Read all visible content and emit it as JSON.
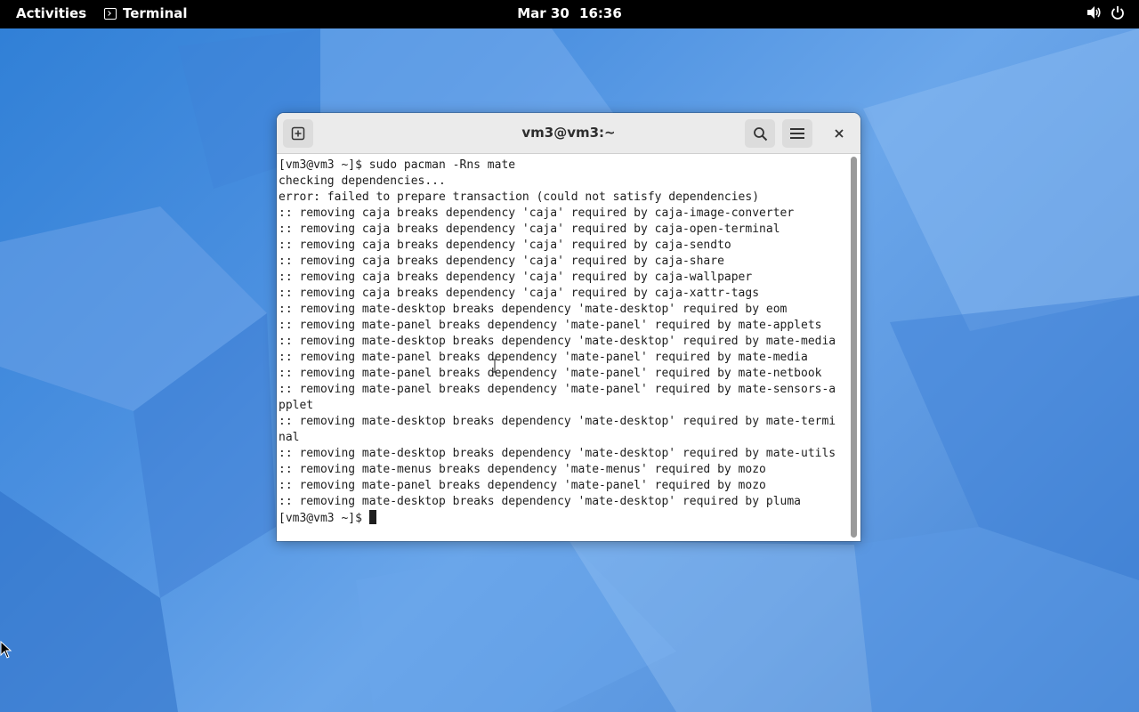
{
  "topbar": {
    "activities": "Activities",
    "app_name": "Terminal",
    "date": "Mar 30",
    "time": "16:36",
    "icons": [
      "terminal-icon",
      "volume-icon",
      "power-icon"
    ]
  },
  "window": {
    "title": "vm3@vm3:~",
    "buttons": [
      "new-tab-icon",
      "search-icon",
      "hamburger-menu-icon",
      "close-icon"
    ]
  },
  "terminal": {
    "lines": [
      "[vm3@vm3 ~]$ sudo pacman -Rns mate",
      "checking dependencies...",
      "error: failed to prepare transaction (could not satisfy dependencies)",
      ":: removing caja breaks dependency 'caja' required by caja-image-converter",
      ":: removing caja breaks dependency 'caja' required by caja-open-terminal",
      ":: removing caja breaks dependency 'caja' required by caja-sendto",
      ":: removing caja breaks dependency 'caja' required by caja-share",
      ":: removing caja breaks dependency 'caja' required by caja-wallpaper",
      ":: removing caja breaks dependency 'caja' required by caja-xattr-tags",
      ":: removing mate-desktop breaks dependency 'mate-desktop' required by eom",
      ":: removing mate-panel breaks dependency 'mate-panel' required by mate-applets",
      ":: removing mate-desktop breaks dependency 'mate-desktop' required by mate-media",
      ":: removing mate-panel breaks dependency 'mate-panel' required by mate-media",
      ":: removing mate-panel breaks dependency 'mate-panel' required by mate-netbook",
      ":: removing mate-panel breaks dependency 'mate-panel' required by mate-sensors-a",
      "pplet",
      ":: removing mate-desktop breaks dependency 'mate-desktop' required by mate-termi",
      "nal",
      ":: removing mate-desktop breaks dependency 'mate-desktop' required by mate-utils",
      ":: removing mate-menus breaks dependency 'mate-menus' required by mozo",
      ":: removing mate-panel breaks dependency 'mate-panel' required by mozo",
      ":: removing mate-desktop breaks dependency 'mate-desktop' required by pluma"
    ],
    "prompt": "[vm3@vm3 ~]$ "
  },
  "colors": {
    "topbar": "#000000",
    "titlebar": "#ebebeb",
    "terminal_bg": "#ffffff",
    "terminal_fg": "#1e1e1e",
    "desktop": "#4b90e0"
  }
}
